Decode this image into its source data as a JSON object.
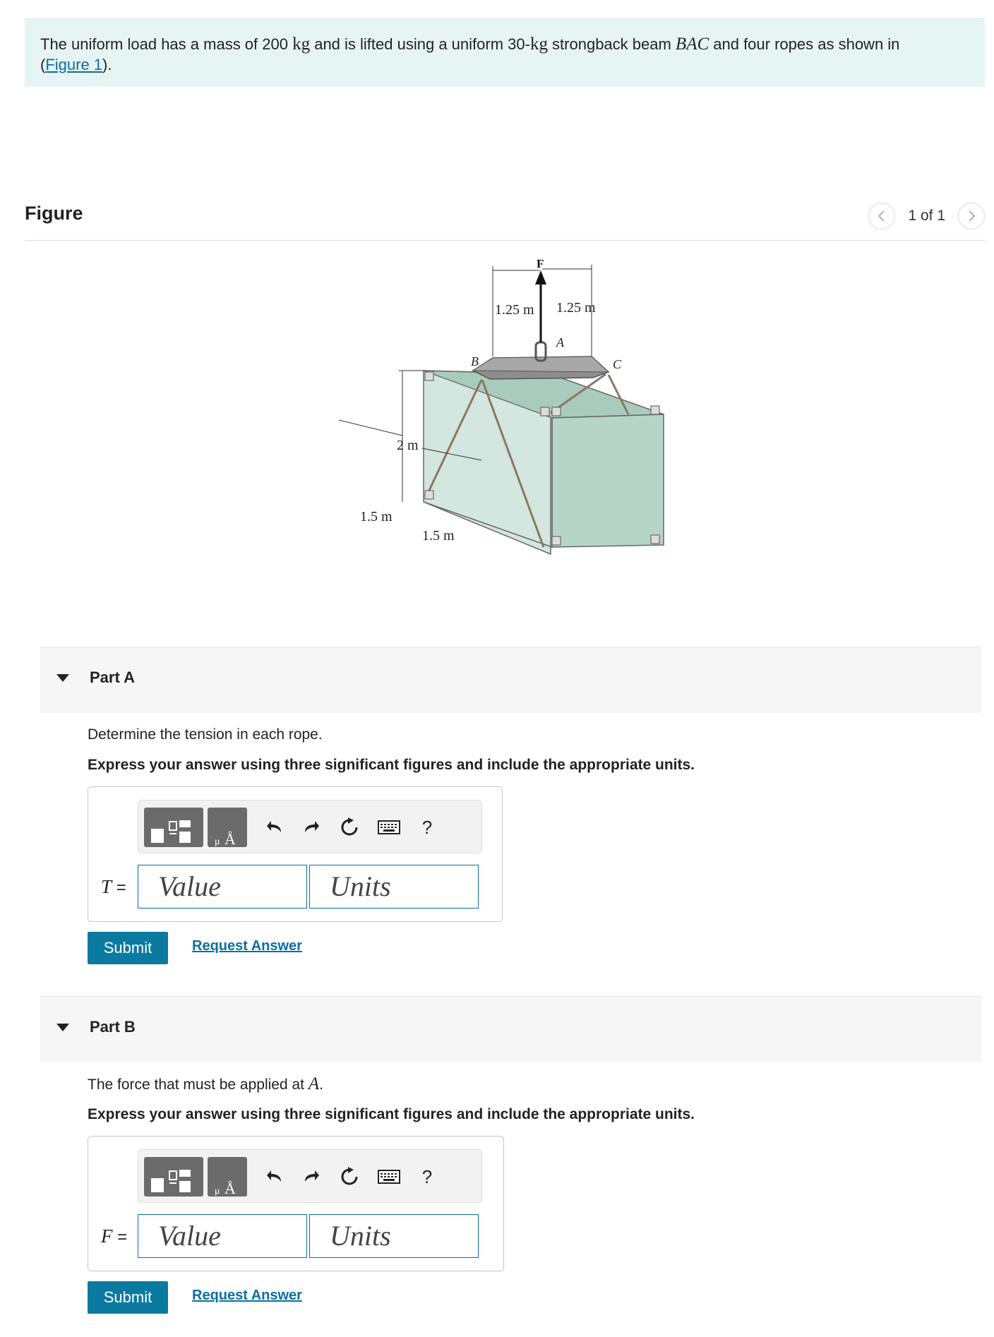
{
  "problem": {
    "text_1": "The uniform load has a mass of 200 ",
    "unit_kg": "kg",
    "text_2": " and is lifted using a uniform 30-",
    "unit_kg_2": "kg",
    "text_3": " strongback beam ",
    "beam": "BAC",
    "text_4": " and four ropes as shown in",
    "paren_open": "(",
    "figure_link": "Figure 1",
    "paren_close": ")."
  },
  "figure": {
    "title": "Figure",
    "pager_text": "1 of 1",
    "labels": {
      "force": "F",
      "dim_left": "1.25 m",
      "dim_right": "1.25 m",
      "point_a": "A",
      "point_b": "B",
      "point_c": "C",
      "height": "2 m",
      "depth": "1.5 m",
      "width": "1.5 m"
    }
  },
  "parts": [
    {
      "title": "Part A",
      "question_prefix": "Determine the tension in each rope.",
      "instruction": "Express your answer using three significant figures and include the appropriate units.",
      "variable": "T",
      "equals": " =",
      "value_placeholder": "Value",
      "units_placeholder": "Units",
      "submit": "Submit",
      "request": "Request Answer",
      "help": "?"
    },
    {
      "title": "Part B",
      "question_prefix": "The force that must be applied at ",
      "question_var": "A",
      "question_suffix": ".",
      "instruction": "Express your answer using three significant figures and include the appropriate units.",
      "variable": "F",
      "equals": " =",
      "value_placeholder": "Value",
      "units_placeholder": "Units",
      "submit": "Submit",
      "request": "Request Answer",
      "help": "?"
    }
  ],
  "toolbar_icons": [
    "templates-icon",
    "units-angstrom-icon",
    "undo-icon",
    "redo-icon",
    "reset-icon",
    "keyboard-icon",
    "help-icon"
  ],
  "colors": {
    "accent": "#0b7aa1",
    "link": "#0a6ea3",
    "problem_bg": "#e6f4f4",
    "crate": "#bcd7cc"
  }
}
